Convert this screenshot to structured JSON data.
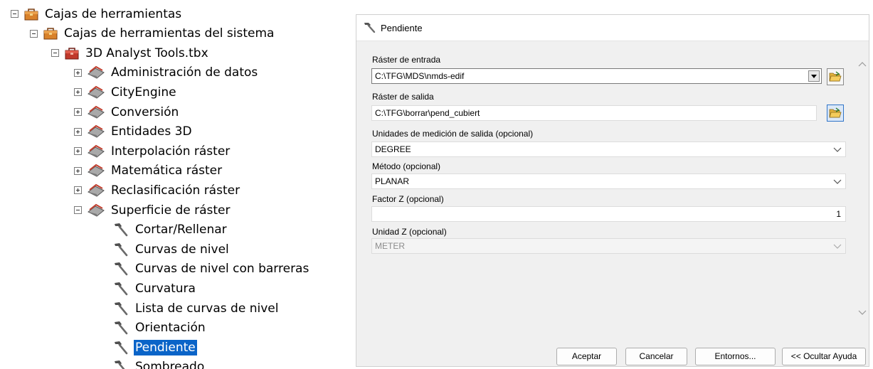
{
  "tree": {
    "items": [
      {
        "label": "Cajas de herramientas",
        "icon": "toolbox-icon",
        "expander": "minus"
      },
      {
        "label": "Cajas de herramientas del sistema",
        "icon": "toolbox-icon",
        "expander": "minus"
      },
      {
        "label": "3D Analyst Tools.tbx",
        "icon": "toolbox-red-icon",
        "expander": "minus"
      },
      {
        "label": "Administración de datos",
        "icon": "toolset-icon",
        "expander": "plus"
      },
      {
        "label": "CityEngine",
        "icon": "toolset-icon",
        "expander": "plus"
      },
      {
        "label": "Conversión",
        "icon": "toolset-icon",
        "expander": "plus"
      },
      {
        "label": "Entidades 3D",
        "icon": "toolset-icon",
        "expander": "plus"
      },
      {
        "label": "Interpolación ráster",
        "icon": "toolset-icon",
        "expander": "plus"
      },
      {
        "label": "Matemática ráster",
        "icon": "toolset-icon",
        "expander": "plus"
      },
      {
        "label": "Reclasificación ráster",
        "icon": "toolset-icon",
        "expander": "plus"
      },
      {
        "label": "Superficie de ráster",
        "icon": "toolset-icon",
        "expander": "minus"
      },
      {
        "label": "Cortar/Rellenar",
        "icon": "hammer-icon"
      },
      {
        "label": "Curvas de nivel",
        "icon": "hammer-icon"
      },
      {
        "label": "Curvas de nivel con barreras",
        "icon": "hammer-icon"
      },
      {
        "label": "Curvatura",
        "icon": "hammer-icon"
      },
      {
        "label": "Lista de curvas de nivel",
        "icon": "hammer-icon"
      },
      {
        "label": "Orientación",
        "icon": "hammer-icon"
      },
      {
        "label": "Pendiente",
        "icon": "hammer-icon",
        "selected": true
      },
      {
        "label": "Sombreado",
        "icon": "hammer-icon"
      }
    ]
  },
  "dialog": {
    "title": "Pendiente",
    "fields": {
      "input_raster": {
        "label": "Ráster de entrada",
        "value": "C:\\TFG\\MDS\\nmds-edif"
      },
      "output_raster": {
        "label": "Ráster de salida",
        "value": "C:\\TFG\\borrar\\pend_cubiert"
      },
      "output_units": {
        "label": "Unidades de medición de salida (opcional)",
        "value": "DEGREE"
      },
      "method": {
        "label": "Método (opcional)",
        "value": "PLANAR"
      },
      "z_factor": {
        "label": "Factor Z (opcional)",
        "value": "1"
      },
      "z_unit": {
        "label": "Unidad Z (opcional)",
        "value": "METER"
      }
    },
    "buttons": {
      "ok": "Aceptar",
      "cancel": "Cancelar",
      "environments": "Entornos...",
      "help": "<< Ocultar Ayuda"
    }
  },
  "colors": {
    "selection": "#0a64c8",
    "toolbox_red": "#c0392b",
    "toolbox_orange": "#d9822b"
  }
}
